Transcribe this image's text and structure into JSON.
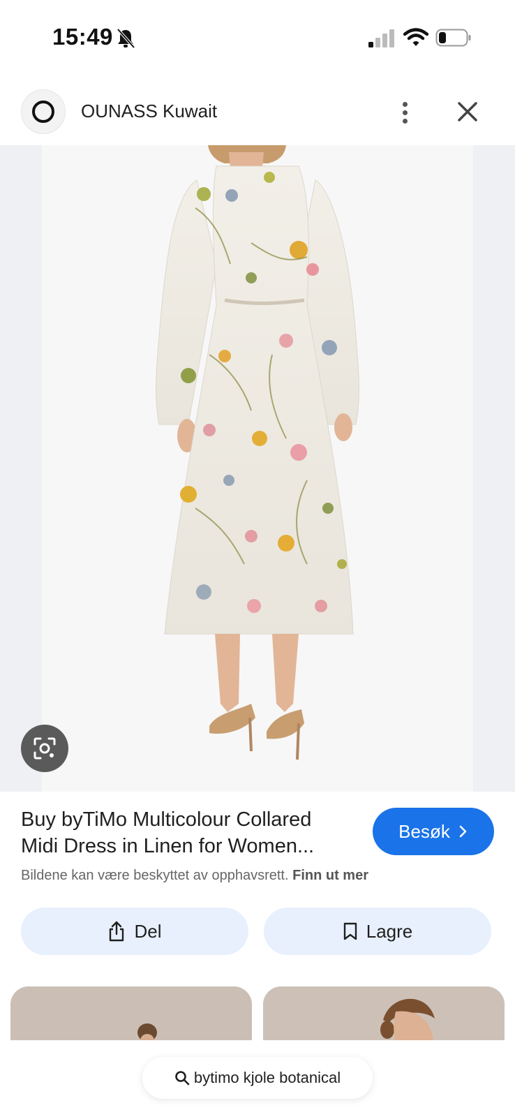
{
  "status_bar": {
    "time": "15:49",
    "icons": [
      "bell-slash-icon",
      "signal-icon",
      "wifi-icon",
      "battery-icon"
    ]
  },
  "header": {
    "site_name": "OUNASS Kuwait",
    "icons": [
      "site-logo",
      "more-vertical-icon",
      "close-icon"
    ]
  },
  "result": {
    "title_line1": "Buy byTiMo Multicolour Collared",
    "title_line2": "Midi Dress in Linen for Women...",
    "visit_label": "Besøk",
    "copyright_text": "Bildene kan være beskyttet av opphavsrett.",
    "copyright_link": "Finn ut mer"
  },
  "actions": {
    "share_label": "Del",
    "save_label": "Lagre"
  },
  "search": {
    "query": "bytimo kjole botanical"
  },
  "colors": {
    "accent": "#1a73e8",
    "action_bg": "#e8f0fe"
  }
}
